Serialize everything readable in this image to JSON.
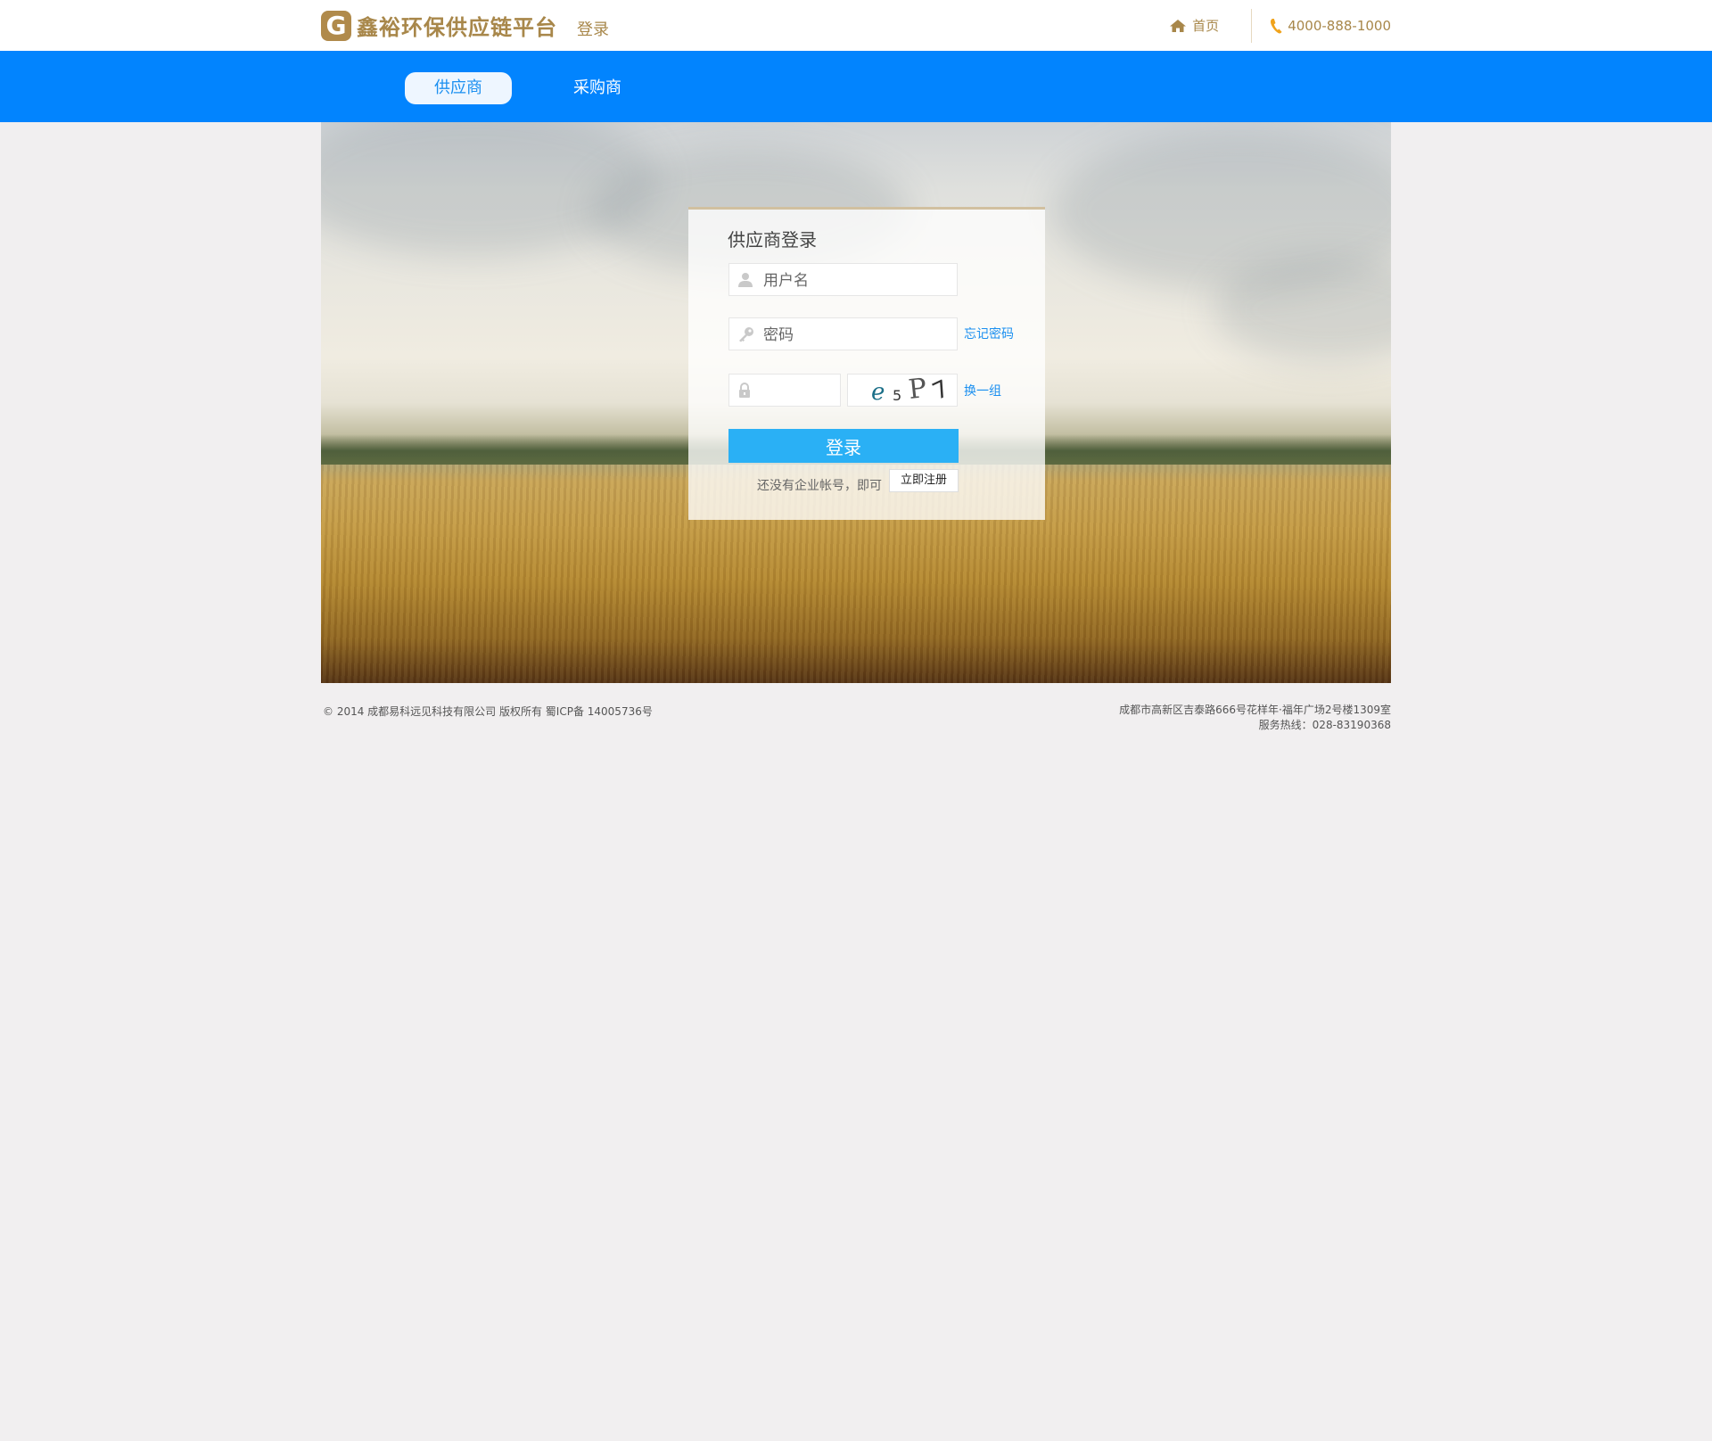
{
  "header": {
    "logo_mark": "G",
    "brand": "鑫裕环保供应链平台",
    "page_label": "登录",
    "home_label": "首页",
    "phone": "4000-888-1000",
    "accent_color": "#a8874a"
  },
  "nav": {
    "tabs": [
      {
        "label": "供应商",
        "active": true
      },
      {
        "label": "采购商",
        "active": false
      }
    ],
    "bar_color": "#0284fe"
  },
  "login": {
    "title": "供应商登录",
    "username_placeholder": "用户名",
    "password_placeholder": "密码",
    "forgot_label": "忘记密码",
    "captcha_chars": [
      "e",
      "5",
      "P",
      "7"
    ],
    "refresh_captcha_label": "换一组",
    "submit_label": "登录",
    "register_tip": "还没有企业帐号，即可",
    "register_label": "立即注册",
    "button_color": "#2ab0f5"
  },
  "footer": {
    "copyright": "© 2014 成都易科远见科技有限公司 版权所有 蜀ICP备 14005736号",
    "address": "成都市高新区吉泰路666号花样年·福年广场2号楼1309室",
    "hotline": "服务热线：028-83190368"
  }
}
